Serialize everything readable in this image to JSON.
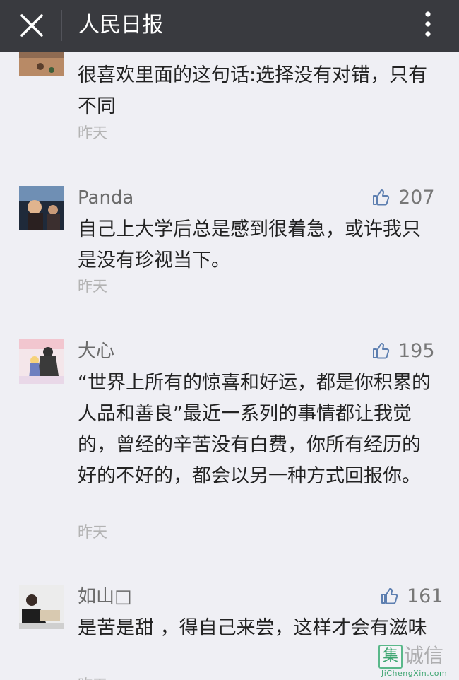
{
  "header": {
    "title": "人民日报"
  },
  "comments": [
    {
      "name": "",
      "likes": "",
      "text": "很喜欢里面的这句话:选择没有对错，只有不同",
      "time": "昨天"
    },
    {
      "name": "Panda",
      "likes": "207",
      "text": "自己上大学后总是感到很着急，或许我只是没有珍视当下。",
      "time": "昨天"
    },
    {
      "name": "大心",
      "likes": "195",
      "text": "“世界上所有的惊喜和好运，都是你积累的人品和善良”最近一系列的事情都让我觉的，曾经的辛苦没有白费，你所有经历的好的不好的，都会以另一种方式回报你。",
      "time": "昨天"
    },
    {
      "name": "如山□",
      "likes": "161",
      "text": "是苦是甜 ，得自己来尝，这样才会有滋味",
      "time": "昨天"
    }
  ],
  "watermark": {
    "cn": "诚信",
    "icon_char": "集",
    "en": "JiChengXin.com"
  },
  "icons": [
    "close-icon",
    "more-vertical-icon",
    "thumbs-up-icon"
  ],
  "colors": {
    "topbar": "#393a3f",
    "background": "#efeff4",
    "like_icon": "#5d7fb0",
    "watermark_green": "#3fa672"
  }
}
